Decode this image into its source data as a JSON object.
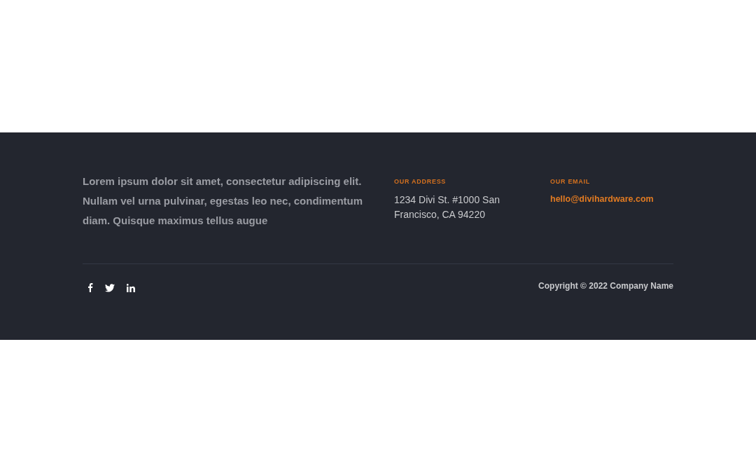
{
  "footer": {
    "about": "Lorem ipsum dolor sit amet, consectetur adipiscing elit. Nullam vel urna pulvinar, egestas leo nec, condimentum diam. Quisque maximus tellus augue",
    "address": {
      "heading": "OUR ADDRESS",
      "text": "1234 Divi St. #1000 San Francisco, CA 94220"
    },
    "email": {
      "heading": "OUR EMAIL",
      "text": "hello@divihardware.com"
    },
    "social_links": [
      {
        "kind": "facebook"
      },
      {
        "kind": "twitter"
      },
      {
        "kind": "linkedin"
      }
    ],
    "copyright": "Copyright © 2022 Company Name"
  }
}
